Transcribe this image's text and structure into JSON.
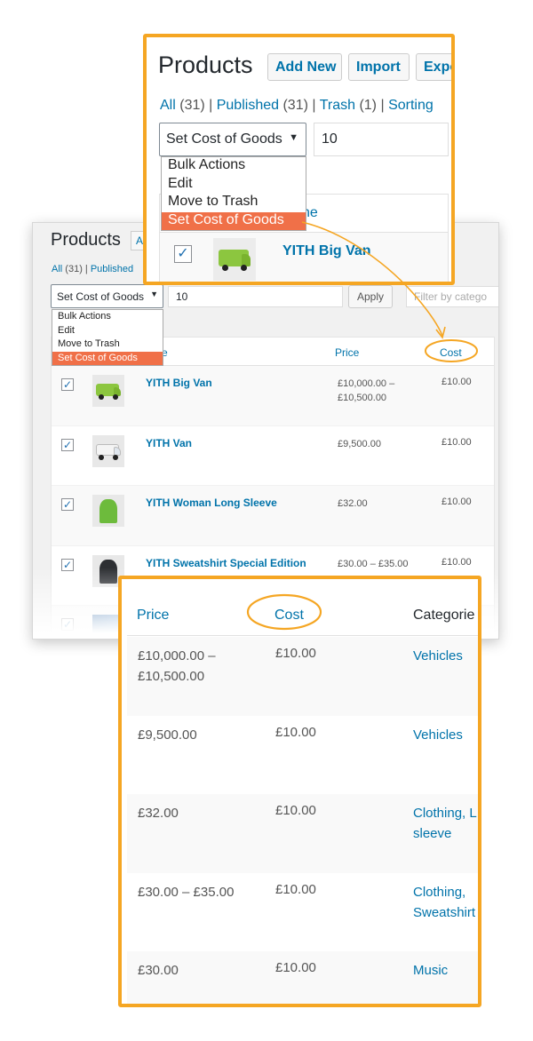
{
  "main": {
    "title": "Products",
    "add_new_fragment": "A",
    "subsub": {
      "all": "All",
      "all_count": "(31)",
      "published": "Published"
    },
    "bulk_select": "Set Cost of Goods",
    "bulk_value": "10",
    "apply_label": "Apply",
    "filter_placeholder": "Filter by catego",
    "dropdown": [
      "Bulk Actions",
      "Edit",
      "Move to Trash",
      "Set Cost of Goods"
    ],
    "columns": {
      "name_fragment": "me",
      "price": "Price",
      "cost": "Cost"
    },
    "rows": [
      {
        "name": "YITH Big Van",
        "price": "£10,000.00 –",
        "price2": "£10,500.00",
        "cost": "£10.00"
      },
      {
        "name": "YITH Van",
        "price": "£9,500.00",
        "price2": "",
        "cost": "£10.00"
      },
      {
        "name": "YITH Woman Long Sleeve",
        "price": "£32.00",
        "price2": "",
        "cost": "£10.00"
      },
      {
        "name": "YITH Sweatshirt Special Edition",
        "price": "£30.00 – £35.00",
        "price2": "",
        "cost": "£10.00"
      },
      {
        "name": "",
        "price": "",
        "price2": "",
        "cost": ""
      }
    ]
  },
  "zoom_top": {
    "title": "Products",
    "add_new": "Add New",
    "import": "Import",
    "export_fragment": "Expo",
    "subsub": {
      "all": "All",
      "all_count": "(31)",
      "published": "Published",
      "published_count": "(31)",
      "trash": "Trash",
      "trash_count": "(1)",
      "sorting": "Sorting"
    },
    "bulk_select": "Set Cost of Goods",
    "bulk_value": "10",
    "dropdown": [
      "Bulk Actions",
      "Edit",
      "Move to Trash",
      "Set Cost of Goods"
    ],
    "name_col_fragment": "ne",
    "row_name": "YITH Big Van"
  },
  "zoom_bottom": {
    "columns": {
      "price": "Price",
      "cost": "Cost",
      "categories": "Categorie"
    },
    "rows": [
      {
        "price": "£10,000.00 –",
        "price2": "£10,500.00",
        "cost": "£10.00",
        "cat": "Vehicles",
        "cat2": ""
      },
      {
        "price": "£9,500.00",
        "price2": "",
        "cost": "£10.00",
        "cat": "Vehicles",
        "cat2": ""
      },
      {
        "price": "£32.00",
        "price2": "",
        "cost": "£10.00",
        "cat": "Clothing, L",
        "cat2": "sleeve"
      },
      {
        "price": "£30.00 – £35.00",
        "price2": "",
        "cost": "£10.00",
        "cat": "Clothing,",
        "cat2": "Sweatshirt"
      },
      {
        "price": "£30.00",
        "price2": "",
        "cost": "£10.00",
        "cat": "Music",
        "cat2": ""
      }
    ]
  },
  "colors": {
    "accent": "#f5a623",
    "link": "#0073aa",
    "selected": "#f07048"
  },
  "icons": {
    "checkbox_checked": "checkmark-icon",
    "dropdown_caret": "caret-down-icon"
  }
}
